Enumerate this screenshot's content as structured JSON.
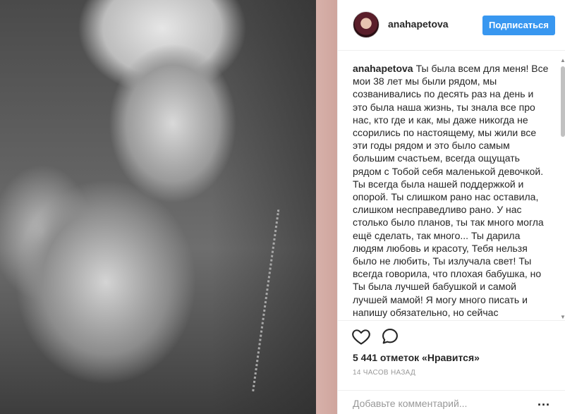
{
  "post": {
    "username": "anahapetova",
    "follow_label": "Подписаться",
    "caption_text": "Ты была всем для меня! Все мои 38 лет мы были рядом, мы созванивались по десять раз на день и это была наша жизнь, ты знала все про нас, кто где и как, мы даже никогда не ссорились по настоящему, мы жили все эти годы рядом и это было самым большим счастьем, всегда ощущать рядом с Тобой себя маленькой девочкой. Ты всегда была нашей поддержкой и опорой. Ты слишком рано нас оставила, слишком несправедливо рано. У нас столько было планов, ты так много могла ещё сделать, так много... Ты дарила людям любовь и красоту, Тебя нельзя было не любить, Ты излучала свет! Ты всегда говорила, что плохая бабушка, но Ты была лучшей бабушкой и самой лучшей мамой! Я могу много писать и напишу обязательно, но сейчас",
    "likes": "5 441 отметок «Нравится»",
    "time": "14 ЧАСОВ НАЗАД",
    "comment_placeholder": "Добавьте комментарий...",
    "more_label": "..."
  },
  "colors": {
    "accent": "#3897f0",
    "border": "#efefef",
    "muted": "#999999"
  },
  "icons": [
    "heart-icon",
    "comment-icon",
    "more-options-icon"
  ]
}
